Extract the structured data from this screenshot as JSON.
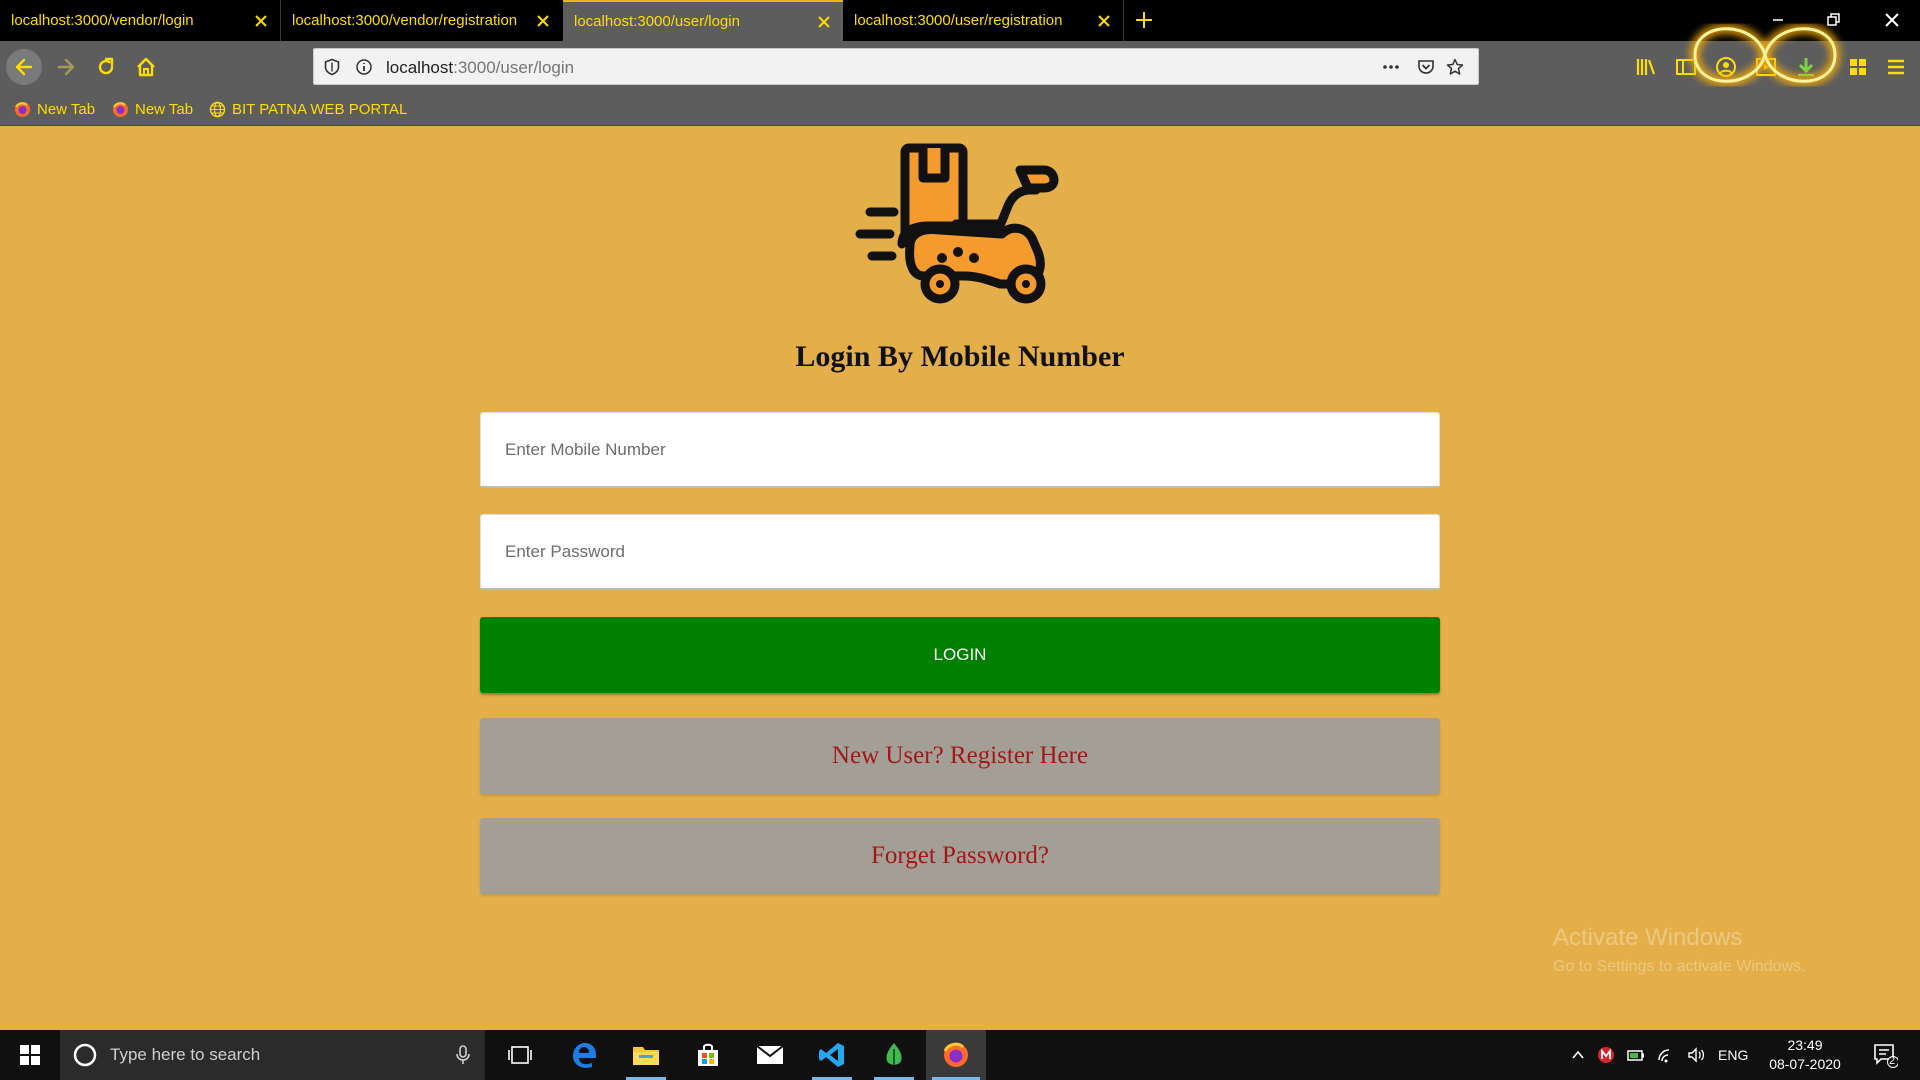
{
  "browser": {
    "tabs": [
      {
        "label": "localhost:3000/vendor/login",
        "active": false
      },
      {
        "label": "localhost:3000/vendor/registration",
        "active": false
      },
      {
        "label": "localhost:3000/user/login",
        "active": true
      },
      {
        "label": "localhost:3000/user/registration",
        "active": false
      }
    ],
    "url": {
      "host": "localhost",
      "path": ":3000/user/login"
    },
    "bookmarks": [
      {
        "label": "New Tab",
        "icon": "firefox-icon"
      },
      {
        "label": "New Tab",
        "icon": "firefox-icon"
      },
      {
        "label": "BIT PATNA WEB PORTAL",
        "icon": "globe-icon"
      }
    ],
    "accent_color": "#ffdd00"
  },
  "page": {
    "background_color": "#e4ae48",
    "title": "Login By Mobile Number",
    "mobile_input": {
      "placeholder": "Enter Mobile Number",
      "value": ""
    },
    "password_input": {
      "placeholder": "Enter Password",
      "value": ""
    },
    "login_button": "LOGIN",
    "login_button_color": "#008000",
    "register_link": "New User? Register Here",
    "forgot_link": "Forget Password?",
    "link_color": "#a41717"
  },
  "watermark": {
    "line1": "Activate Windows",
    "line2": "Go to Settings to activate Windows."
  },
  "taskbar": {
    "search_placeholder": "Type here to search",
    "language": "ENG",
    "time": "23:49",
    "date": "08-07-2020",
    "notification_count": "2"
  }
}
